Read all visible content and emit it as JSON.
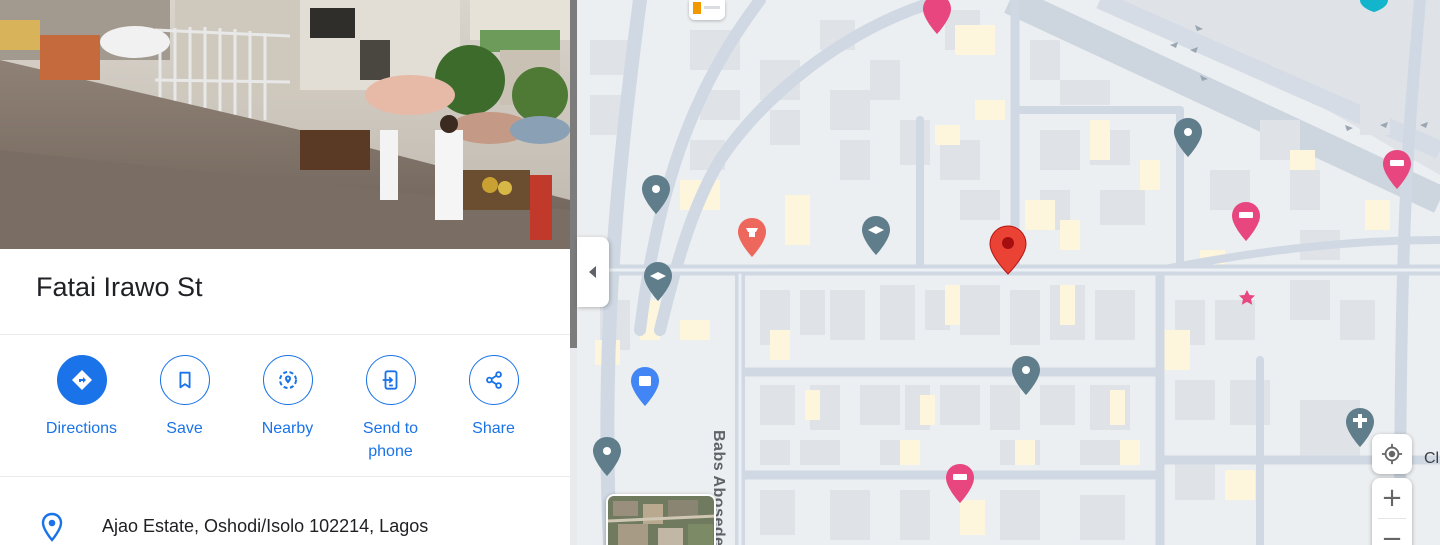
{
  "place": {
    "title": "Fatai Irawo St"
  },
  "actions": [
    {
      "label": "Directions",
      "icon": "directions-icon",
      "primary": true
    },
    {
      "label": "Save",
      "icon": "bookmark-icon"
    },
    {
      "label": "Nearby",
      "icon": "nearby-icon"
    },
    {
      "label": "Send to phone",
      "icon": "send-to-phone-icon"
    },
    {
      "label": "Share",
      "icon": "share-icon"
    }
  ],
  "info": {
    "address": "Ajao Estate, Oshodi/Isolo 102214, Lagos",
    "address_icon": "location-pin-icon"
  },
  "map": {
    "street_label": "Babs Abosede",
    "edge_label": "Cl",
    "zoom_in": "+",
    "zoom_out": "−",
    "colors": {
      "accent": "#1a73e8",
      "red_pin": "#ea4335",
      "gray_pin": "#607d8b",
      "pink_pin": "#e7467f",
      "road": "#cfd8e3",
      "building": "#dfe3e8",
      "building_yellow": "#fdf5dc"
    }
  }
}
